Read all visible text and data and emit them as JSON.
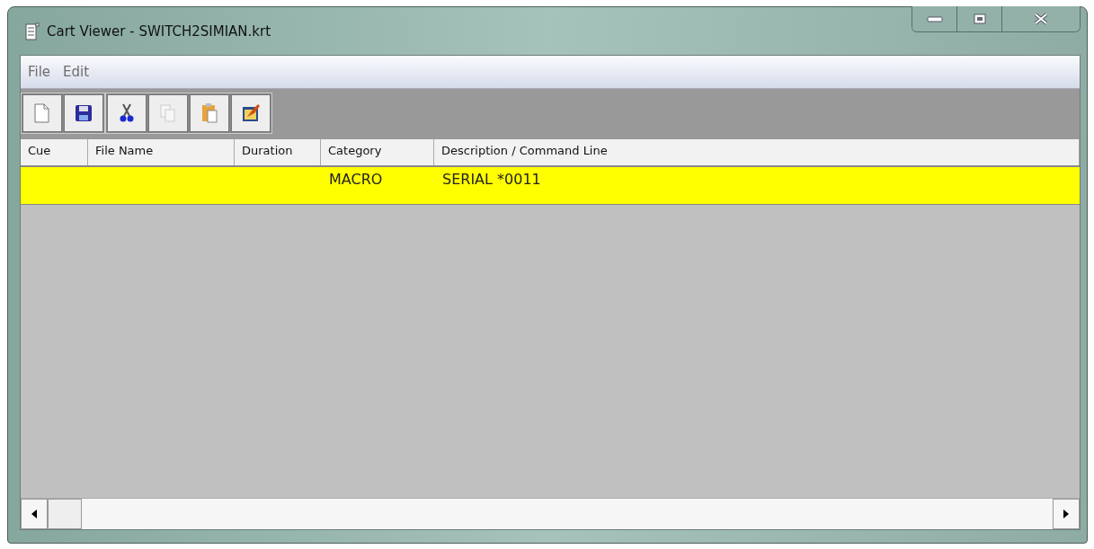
{
  "window": {
    "title": "Cart Viewer - SWITCH2SIMIAN.krt"
  },
  "menu": [
    "File",
    "Edit"
  ],
  "toolbar": [
    [
      {
        "kind": "new",
        "disabled": false
      },
      {
        "kind": "save",
        "disabled": false
      }
    ],
    [
      {
        "kind": "cut",
        "disabled": false
      },
      {
        "kind": "copy",
        "disabled": true
      },
      {
        "kind": "paste",
        "disabled": false
      },
      {
        "kind": "properties",
        "disabled": false
      }
    ]
  ],
  "table": {
    "columns": [
      "Cue",
      "File Name",
      "Duration",
      "Category",
      "Description / Command Line"
    ],
    "rows": [
      {
        "cells": [
          "",
          "",
          "",
          "MACRO",
          "SERIAL *0011"
        ],
        "selected": true
      }
    ]
  }
}
